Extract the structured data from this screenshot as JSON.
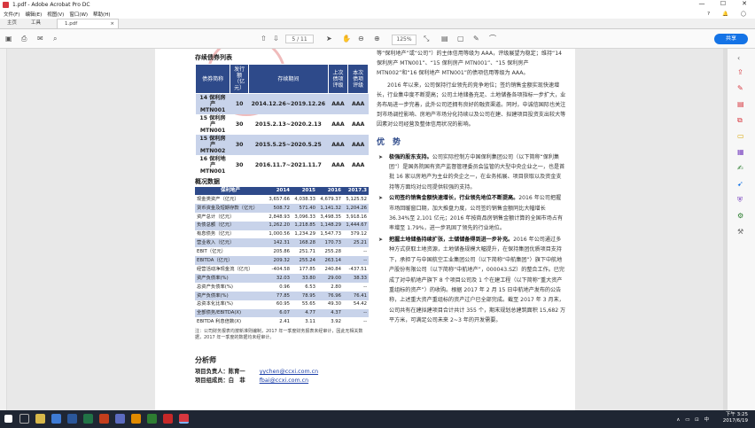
{
  "window": {
    "title": "1.pdf - Adobe Acrobat Pro DC",
    "minimize": "—",
    "maximize": "☐",
    "close": "✕"
  },
  "menu": [
    "文件(F)",
    "编辑(E)",
    "视图(V)",
    "窗口(W)",
    "帮助(H)"
  ],
  "menu_right_icons": [
    "help-icon",
    "bell-icon",
    "sign-in"
  ],
  "tabs": {
    "home": "主页",
    "tools": "工具",
    "doc": "1.pdf",
    "doc_close": "×"
  },
  "toolbar": {
    "page_current": "5",
    "page_total": "/ 11",
    "zoom": "125%",
    "share": "共享"
  },
  "bond_table": {
    "title": "存续债券列表",
    "headers": [
      "债券简称",
      "发行额（亿元）",
      "存续期间",
      "上次债项评级",
      "本次债项评级"
    ],
    "rows": [
      [
        "14 保利房产MTN001",
        "10",
        "2014.12.26~2019.12.26",
        "AAA",
        "AAA"
      ],
      [
        "15 保利房产MTN001",
        "30",
        "2015.2.13~2020.2.13",
        "AAA",
        "AAA"
      ],
      [
        "15 保利房产MTN002",
        "30",
        "2015.5.25~2020.5.25",
        "AAA",
        "AAA"
      ],
      [
        "16 保利地产MTN001",
        "30",
        "2016.11.7~2021.11.7",
        "AAA",
        "AAA"
      ]
    ]
  },
  "fin_table": {
    "title": "概况数据",
    "headers": [
      "保利地产",
      "2014",
      "2015",
      "2016",
      "2017.3"
    ],
    "rows": [
      [
        "现金类资产（亿元）",
        "3,657.66",
        "4,038.33",
        "4,679.37",
        "5,125.52"
      ],
      [
        "货币资金及短期存款（亿元）",
        "508.72",
        "571.40",
        "1,141.32",
        "1,204.26"
      ],
      [
        "资产总计（亿元）",
        "2,848.93",
        "3,096.33",
        "3,498.35",
        "3,918.16"
      ],
      [
        "负债总额（亿元）",
        "1,262.20",
        "1,218.85",
        "1,148.29",
        "1,444.67"
      ],
      [
        "有息债务（亿元）",
        "1,000.56",
        "1,234.29",
        "1,547.73",
        "379.12"
      ],
      [
        "营业收入（亿元）",
        "142.31",
        "168.28",
        "170.73",
        "25.21"
      ],
      [
        "EBIT（亿元）",
        "205.86",
        "251.71",
        "255.28",
        "--"
      ],
      [
        "EBITDA（亿元）",
        "209.32",
        "255.24",
        "263.14",
        "--"
      ],
      [
        "经营活动净现金流（亿元）",
        "-404.58",
        "177.85",
        "240.84",
        "-437.51"
      ],
      [
        "资产负债率(%)",
        "32.03",
        "33.80",
        "29.00",
        "38.33"
      ],
      [
        "总资产负债率(%)",
        "0.96",
        "6.53",
        "2.80",
        "--"
      ],
      [
        "资产负债率(%)",
        "77.85",
        "78.95",
        "76.96",
        "76.41"
      ],
      [
        "总资本化比率(%)",
        "60.95",
        "55.65",
        "49.30",
        "54.42"
      ],
      [
        "全部债务/EBITDA(X)",
        "6.07",
        "4.77",
        "4.37",
        "--"
      ],
      [
        "EBITDA 利息倍数(X)",
        "2.41",
        "3.11",
        "3.92",
        "--"
      ]
    ],
    "note": "注：公司财务报表均按新准则编制，2017 年一季度财务报表未经审计，因此无相关数据，2017 年一季度的数据均未经审计。"
  },
  "analysts": {
    "title": "分析师",
    "lead_label": "项目负责人：陈育一",
    "lead_email": "yychen@ccxi.com.cn",
    "member_label": "项目组成员：白　菲",
    "member_email": "fbai@ccxi.com.cn"
  },
  "right_col": {
    "p1": "等“保利地产”或“公司”）的主体信用等级为 AAA，评级展望为稳定；维持“14 保利房产 MTN001”、“15 保利房产 MTN001”、“15 保利房产 MTN002”和“16 保利地产 MTN001”的债项信用等级为 AAA。",
    "p2": "2016 年以来，公司保持行业领先的竞争地位；签约销售金额实现快速增长，行业集中度不断提高；公司土地储备充足、土地储备各项指标一步扩大，业务布局进一步完善，此外公司还拥有良好的融资渠道。同时，中诚信国际也关注到市场调控影响、房地产市场分化持续以及公司在建、拟建项目投资支出较大等因素对公司经营及整体信用状况的影响。",
    "section": "优　势",
    "advantages": [
      {
        "bold": "极强的股东支持。",
        "text": "公司实际控制方中国保利集团公司（以下简称“保利集团”）是国务院国有资产监督管理委员会监管的大型中央企业之一，也是首批 16 家以房地产为主业的央企之一，在业务拓展、项目获取以及资金支持等方面均对公司提供较强的支持。"
      },
      {
        "bold": "公司签约销售金额快速增长，行业领先地位不断提高。",
        "text": "2016 年公司把握市场回暖窗口期，加大推盘力度，公司签约销售金额同比大幅增长 36.34%至 2,101 亿元；2016 年按商品房销售金额计算的全国市场占有率增至 1.79%，进一步巩固了领先的行业地位。"
      },
      {
        "bold": "把握土地储备持续扩张，土储储备得到进一步补充。",
        "text": "2016 年公司通过多种方式获取土地资源，土地储备规模大幅提升，在保持集团优质项目支持下，承担了与中国航空工业集团公司（以下简称“中航集团”）旗下中航地产股份有限公司（以下简称“中航地产”，000043.SZ）的整合工作。已完成了对中航地产旗下 8 个项目公司及 1 个在建工程（以下简称“重大资产重组标的资产”）的收购。根据 2017 年 2 月 15 日中航地产发布的公告称，上述重大资产重组标的资产过户已全部完成。截至 2017 年 3 月末，公司共有在建拟建项目合计共计 355 个，期末规划总建筑面积 15,682 万平方米，可满足公司未来 2~3 年的开发需要。"
      }
    ]
  },
  "right_tools": [
    "export-pdf-icon",
    "edit-pdf-icon",
    "create-pdf-icon",
    "comment-icon",
    "combine-icon",
    "organize-icon",
    "fill-sign-icon",
    "send-icon",
    "protect-icon",
    "more-tools-icon"
  ],
  "taskbar": {
    "time": "下午 3:25",
    "date": "2017/6/19",
    "sys": "∧ ▭ ⊡ 中"
  }
}
